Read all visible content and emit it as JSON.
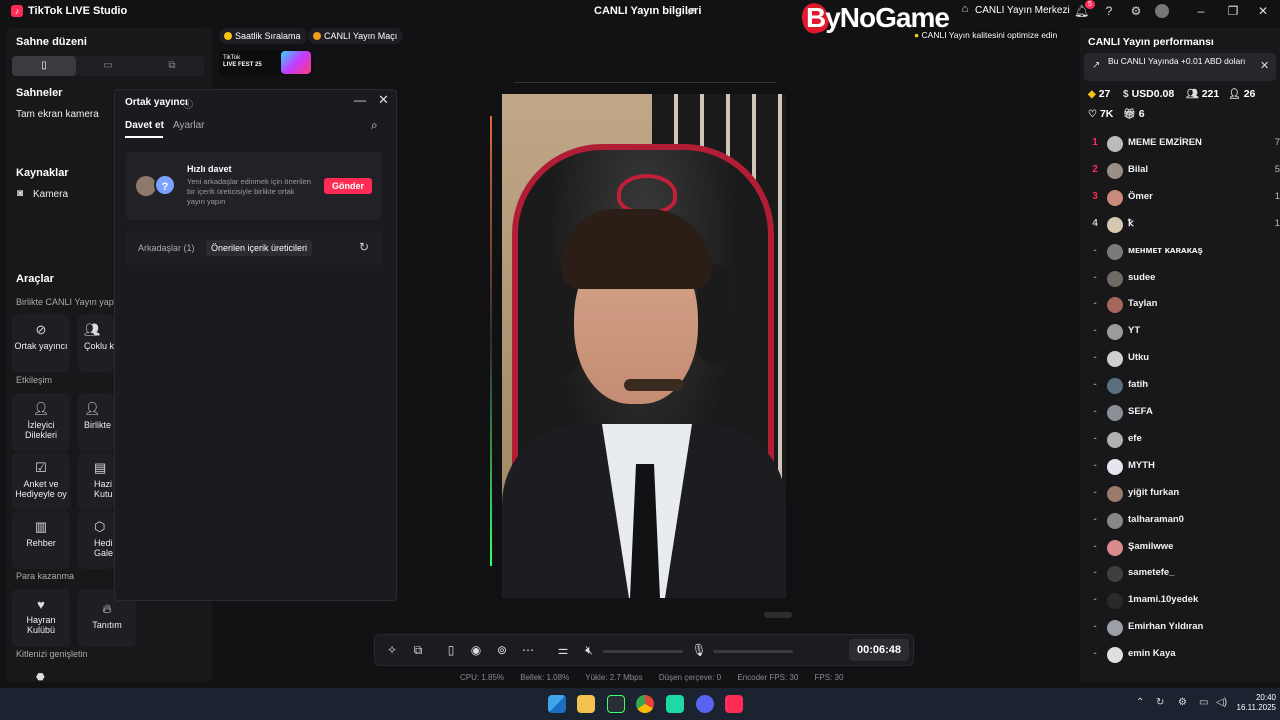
{
  "window": {
    "app_title": "TikTok LIVE Studio",
    "app_logo": "♪",
    "center_title": "CANLI Yayın bilgileri",
    "live_center": "CANLI Yayın Merkezi",
    "brand": "ByNoGame",
    "notification_count": "5",
    "quality_tip": "CANLI Yayın kalitesini optimize edin"
  },
  "left": {
    "scene_title": "Sahne düzeni",
    "scenes_title": "Sahneler",
    "scene_item": "Tam ekran kamera",
    "sources_title": "Kaynaklar",
    "source_item": "Kamera",
    "tools_title": "Araçlar",
    "group_live_together": "Birlikte CANLI Yayın yapın",
    "tool_cohost": "Ortak yayıncı",
    "tool_multi": "Çoklu k",
    "group_interaction": "Etkileşim",
    "tool_viewer_requests": "İzleyici Dilekleri",
    "tool_together": "Birlikte",
    "tool_poll": "Anket ve Hediyeyle oy",
    "tool_treasure": "Hazi Kutu",
    "tool_guide": "Rehber",
    "tool_gift_gallery": "Hedi Gale",
    "group_earn": "Para kazanma",
    "tool_fan_club": "Hayran Kulübü",
    "tool_promo": "Tanıtım",
    "group_expand": "Kitlenizi genişletin"
  },
  "top_pills": {
    "hourly": "Saatlik Sıralama",
    "match": "CANLI Yayın Maçı",
    "fest_line1": "TikTok",
    "fest_line2": "LIVE FEST 25"
  },
  "dialog": {
    "title": "Ortak yayıncı",
    "tab_invite": "Davet et",
    "tab_settings": "Ayarlar",
    "quick_invite_title": "Hızlı davet",
    "quick_invite_desc": "Yeni arkadaşlar edinmek için önerilen bir içerik üreticisiyle birlikte ortak yayın yapın",
    "send_label": "Gönder",
    "friends_tab": "Arkadaşlar (1)",
    "suggested_tab": "Önerilen içerik üreticileri"
  },
  "controls": {
    "timer": "00:06:48"
  },
  "stats": {
    "cpu": "CPU: 1.85%",
    "memory": "Bellek: 1.08%",
    "upload": "Yükle: 2.7 Mbps",
    "dropped": "Düşen çerçeve: 0",
    "encoder_fps": "Encoder FPS: 30",
    "fps": "FPS: 30"
  },
  "performance": {
    "title": "CANLI Yayın performansı",
    "banner": "Bu CANLI Yayında +0.01 ABD doları",
    "diamonds": "27",
    "usd": "USD0.08",
    "viewers": "221",
    "new_followers": "26",
    "likes": "7K",
    "gifts": "6"
  },
  "viewers": [
    {
      "rank": "1",
      "name": "MEME EMZİREN",
      "count": "7",
      "color": "#fe2c55",
      "avatar": "#bbbbbb"
    },
    {
      "rank": "2",
      "name": "Bilal",
      "count": "5",
      "color": "#fe2c55",
      "avatar": "#9a8f86"
    },
    {
      "rank": "3",
      "name": "Ömer",
      "count": "1",
      "color": "#fe2c55",
      "avatar": "#c98a7a"
    },
    {
      "rank": "4",
      "name": "ꝁ",
      "count": "1",
      "color": "#cccccc",
      "avatar": "#d6c8b0"
    },
    {
      "rank": "-",
      "name": "ᴍᴇʜᴍᴇᴛ ᴋᴀʀᴀᴋᴀş",
      "count": "",
      "color": "#888888",
      "avatar": "#7a7a7a"
    },
    {
      "rank": "-",
      "name": "sudee",
      "count": "",
      "color": "#888888",
      "avatar": "#6f6a64"
    },
    {
      "rank": "-",
      "name": "Taylan",
      "count": "",
      "color": "#888888",
      "avatar": "#a5675a"
    },
    {
      "rank": "-",
      "name": "YT",
      "count": "",
      "color": "#888888",
      "avatar": "#9b9b9b"
    },
    {
      "rank": "-",
      "name": "Utku",
      "count": "",
      "color": "#888888",
      "avatar": "#d0d0d0"
    },
    {
      "rank": "-",
      "name": "fatih",
      "count": "",
      "color": "#888888",
      "avatar": "#5a7080"
    },
    {
      "rank": "-",
      "name": "SEFA",
      "count": "",
      "color": "#888888",
      "avatar": "#8a8f96"
    },
    {
      "rank": "-",
      "name": "efe",
      "count": "",
      "color": "#888888",
      "avatar": "#b0b0b0"
    },
    {
      "rank": "-",
      "name": "MYTH",
      "count": "",
      "color": "#888888",
      "avatar": "#e6e6ef"
    },
    {
      "rank": "-",
      "name": "yiğit furkan",
      "count": "",
      "color": "#888888",
      "avatar": "#9a7a6a"
    },
    {
      "rank": "-",
      "name": "talharaman0",
      "count": "",
      "color": "#888888",
      "avatar": "#888888"
    },
    {
      "rank": "-",
      "name": "Şamilwwe",
      "count": "",
      "color": "#888888",
      "avatar": "#d98a8a"
    },
    {
      "rank": "-",
      "name": "sametefe_",
      "count": "",
      "color": "#888888",
      "avatar": "#3f3f3f"
    },
    {
      "rank": "-",
      "name": "1mami.10yedek",
      "count": "",
      "color": "#888888",
      "avatar": "#2a2a2a"
    },
    {
      "rank": "-",
      "name": "Emirhan Yıldıran",
      "count": "",
      "color": "#888888",
      "avatar": "#9aa0a6"
    },
    {
      "rank": "-",
      "name": "emin Kaya",
      "count": "",
      "color": "#888888",
      "avatar": "#e0e0e0"
    }
  ],
  "taskbar": {
    "time": "20:40",
    "date": "16.11.2025"
  }
}
